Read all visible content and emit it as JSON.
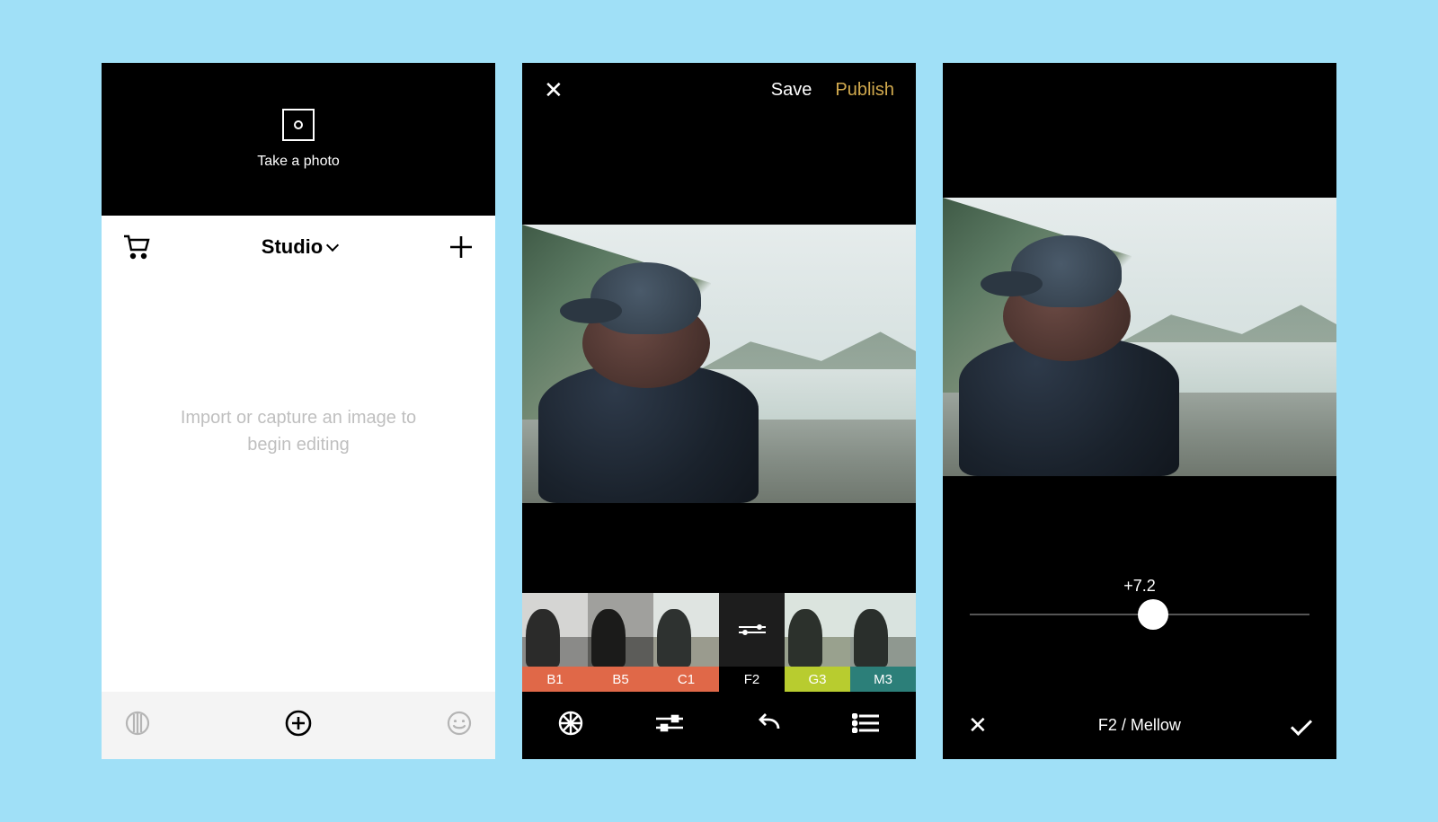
{
  "screen1": {
    "take_photo": "Take a photo",
    "title": "Studio",
    "empty": "Import or capture an image to begin editing"
  },
  "screen2": {
    "save": "Save",
    "publish": "Publish",
    "filters": {
      "b1": "B1",
      "b5": "B5",
      "c1": "C1",
      "f2": "F2",
      "g3": "G3",
      "m3": "M3"
    }
  },
  "screen3": {
    "slider_value": "+7.2",
    "slider_position_percent": 54,
    "filter_name": "F2 / Mellow"
  }
}
